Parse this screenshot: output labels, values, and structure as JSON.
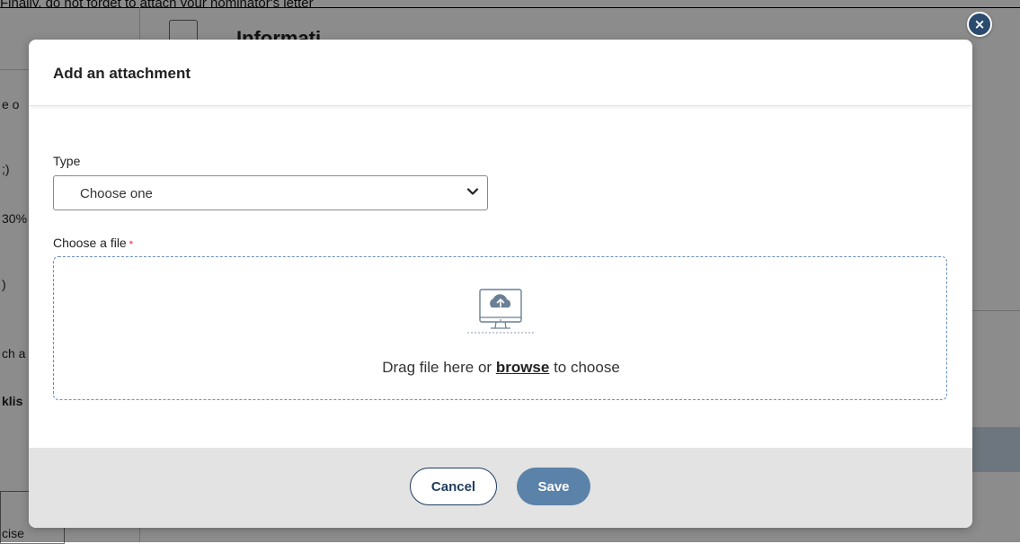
{
  "background": {
    "top_banner": "Finally, do not forget to attach your nominator's letter",
    "section_title": "Informati",
    "left_fragments": [
      "e o",
      ";)",
      "30%",
      ")",
      "ch a",
      "klis",
      "cise"
    ]
  },
  "modal": {
    "title": "Add an attachment",
    "type_label": "Type",
    "type_select": {
      "selected": "Choose one",
      "options": [
        "Choose one"
      ]
    },
    "file_label": "Choose a file",
    "required_mark": "*",
    "dropzone": {
      "text_before": "Drag file here or",
      "browse": "browse",
      "text_after": "to choose",
      "icon": "cloud-upload-monitor-icon"
    },
    "buttons": {
      "cancel": "Cancel",
      "save": "Save"
    },
    "close_glyph": "×"
  },
  "colors": {
    "accent": "#2a4a6e",
    "save_button": "#5b82a8",
    "required": "#d9243b",
    "dropzone_border": "#6c8fb8",
    "footer_bg": "#e3e3e3"
  }
}
